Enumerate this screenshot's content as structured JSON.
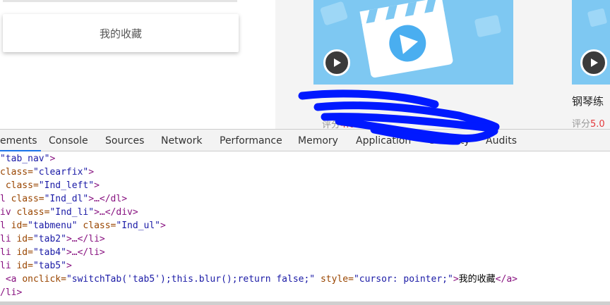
{
  "page": {
    "favorites_label": "我的收藏",
    "course_title_2": "钢琴练",
    "rating_label": "评分",
    "rating_value": "5.0",
    "meta_partial_text": "评分",
    "meta_partial_value": "4.0"
  },
  "icons": {
    "play": "play-icon",
    "clapperboard": "clapperboard-icon"
  },
  "colors": {
    "thumb_blue": "#7ec8f2",
    "scribble_blue": "#0019ff",
    "rating_red": "#e4393c",
    "devtools_accent": "#1a73e8"
  },
  "devtools": {
    "tabs": [
      "ements",
      "Console",
      "Sources",
      "Network",
      "Performance",
      "Memory",
      "Application",
      "Security",
      "Audits"
    ],
    "active_tab": "ements",
    "lines": [
      {
        "p1": "",
        "t": "",
        "a": "",
        "v": "\"tab_nav\"",
        "rest": ">"
      },
      {
        "p1": "",
        "t": "",
        "a": "class=",
        "v": "\"clearfix\"",
        "rest": ">"
      },
      {
        "p1": "",
        "t": "",
        "a": "class=",
        "v": "\"Ind_left\"",
        "rest": ">"
      },
      {
        "p1": "",
        "t": "l ",
        "a": "class=",
        "v": "\"Ind_dl\"",
        "rest": ">…</dl>"
      },
      {
        "p1": "",
        "t": "iv ",
        "a": "class=",
        "v": "\"Ind_li\"",
        "rest": ">…</div>"
      },
      {
        "p1": "",
        "t": "l ",
        "a": "id=",
        "v": "\"tabmenu\"",
        "rest": ""
      },
      {
        "p1": "",
        "t": "li ",
        "a": "id=",
        "v": "\"tab2\"",
        "rest": ">…</li>"
      },
      {
        "p1": "",
        "t": "li ",
        "a": "id=",
        "v": "\"tab4\"",
        "rest": ">…</li>"
      },
      {
        "p1": "",
        "t": "li ",
        "a": "id=",
        "v": "\"tab5\"",
        "rest": ">"
      }
    ],
    "line6_extra_attr": "class=",
    "line6_extra_val": "\"Ind_ul\"",
    "line6_close": ">",
    "anchor_line": {
      "tag_open": "<a ",
      "attr1": "onclick=",
      "val1": "\"switchTab('tab5');this.blur();return false;\"",
      "attr2": "style=",
      "val2": "\"cursor: pointer;\"",
      "gt": ">",
      "text": "我的收藏",
      "tag_close": "</a>"
    },
    "last_line": "/li>"
  }
}
